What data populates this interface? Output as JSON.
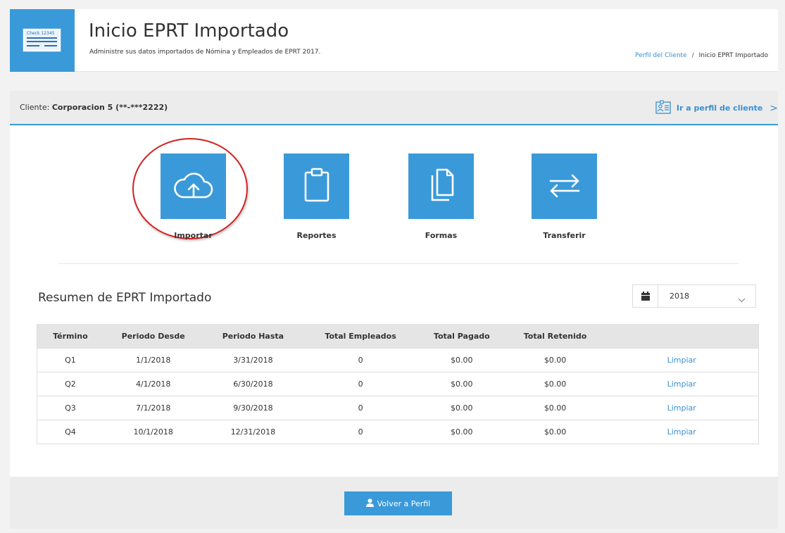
{
  "header": {
    "logo_text": "Check 12345",
    "title": "Inicio EPRT Importado",
    "subtitle": "Administre sus datos importados de Nómina y Empleados de EPRT 2017.",
    "breadcrumb": {
      "link": "Perfil del Cliente",
      "separator": "/",
      "current": "Inicio EPRT Importado"
    }
  },
  "client_bar": {
    "label": "Cliente:",
    "name": "Corporacion 5 (**-***2222)",
    "profile_link": "Ir a perfil de cliente",
    "chevron": ">"
  },
  "actions": [
    {
      "label": "Importar",
      "icon": "cloud-upload-icon"
    },
    {
      "label": "Reportes",
      "icon": "clipboard-icon"
    },
    {
      "label": "Formas",
      "icon": "copy-icon"
    },
    {
      "label": "Transferir",
      "icon": "transfer-arrows-icon"
    }
  ],
  "summary": {
    "title": "Resumen de EPRT Importado",
    "year_selected": "2018",
    "columns": [
      "Término",
      "Periodo Desde",
      "Periodo Hasta",
      "Total Empleados",
      "Total Pagado",
      "Total Retenido",
      ""
    ],
    "rows": [
      {
        "term": "Q1",
        "from": "1/1/2018",
        "to": "3/31/2018",
        "employees": "0",
        "paid": "$0.00",
        "withheld": "$0.00",
        "action": "Limpiar"
      },
      {
        "term": "Q2",
        "from": "4/1/2018",
        "to": "6/30/2018",
        "employees": "0",
        "paid": "$0.00",
        "withheld": "$0.00",
        "action": "Limpiar"
      },
      {
        "term": "Q3",
        "from": "7/1/2018",
        "to": "9/30/2018",
        "employees": "0",
        "paid": "$0.00",
        "withheld": "$0.00",
        "action": "Limpiar"
      },
      {
        "term": "Q4",
        "from": "10/1/2018",
        "to": "12/31/2018",
        "employees": "0",
        "paid": "$0.00",
        "withheld": "$0.00",
        "action": "Limpiar"
      }
    ]
  },
  "footer": {
    "back_button": "Volver a Perfil"
  },
  "colors": {
    "accent": "#3a9ad9",
    "link": "#3a8fd0",
    "highlight": "#d32222"
  }
}
